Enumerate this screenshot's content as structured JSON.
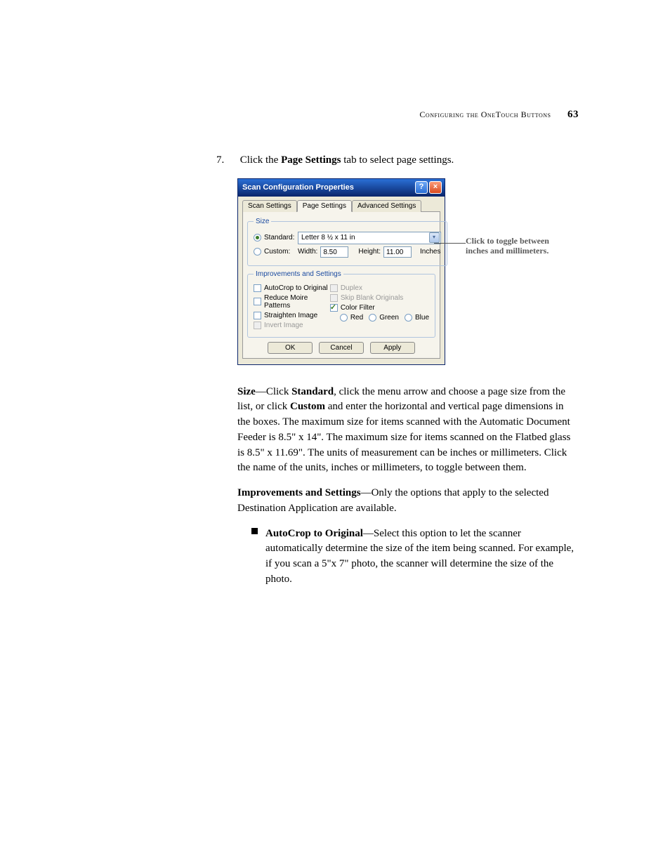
{
  "header": {
    "running_head_1": "Configuring the ",
    "running_head_2": "OneTouch Buttons",
    "page_number": "63"
  },
  "step": {
    "number": "7.",
    "text_prefix": "Click the ",
    "bold": "Page Settings",
    "text_suffix": " tab to select page settings."
  },
  "dialog": {
    "title": "Scan Configuration Properties",
    "tabs": {
      "scan": "Scan Settings",
      "page": "Page Settings",
      "advanced": "Advanced Settings"
    },
    "size_group": {
      "legend": "Size",
      "standard_label": "Standard:",
      "standard_value": "Letter 8 ½ x 11 in",
      "custom_label": "Custom:",
      "width_label": "Width:",
      "width_value": "8.50",
      "height_label": "Height:",
      "height_value": "11.00",
      "units": "Inches"
    },
    "imp_group": {
      "legend": "Improvements and Settings",
      "autocrop": "AutoCrop to Original",
      "moire": "Reduce Moire Patterns",
      "straighten": "Straighten Image",
      "invert": "Invert Image",
      "duplex": "Duplex",
      "skip_blank": "Skip Blank Originals",
      "color_filter": "Color Filter",
      "red": "Red",
      "green": "Green",
      "blue": "Blue"
    },
    "buttons": {
      "ok": "OK",
      "cancel": "Cancel",
      "apply": "Apply"
    }
  },
  "callout": "Click to toggle between inches and millimeters.",
  "paragraphs": {
    "size": {
      "bold1": "Size",
      "t1": "—Click ",
      "bold2": "Standard",
      "t2": ", click the menu arrow and choose a page size from the list, or click ",
      "bold3": "Custom",
      "t3": " and enter the horizontal and vertical page dimensions in the boxes. The maximum size for items scanned with the Automatic Document Feeder is 8.5\" x 14\". The maximum size for items scanned on the Flatbed glass is 8.5\" x 11.69\". The units of measurement can be inches or millimeters. Click the name of the units, inches or millimeters, to toggle between them."
    },
    "imp": {
      "bold1": "Improvements and Settings",
      "t1": "—Only the options that apply to the selected Destination Application are available."
    },
    "bullet1": {
      "bold1": "AutoCrop to Original",
      "t1": "—Select this option to let the scanner automatically determine the size of the item being scanned. For example, if you scan a 5\"x 7\" photo, the scanner will determine the size of the photo."
    }
  }
}
